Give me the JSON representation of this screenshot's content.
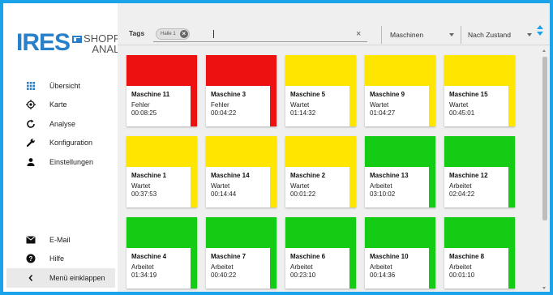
{
  "logo": {
    "brand": "IRES",
    "line1": "SHOPFLOOR",
    "line2": "ANALYTICS"
  },
  "sidebar": {
    "items": [
      {
        "label": "Übersicht",
        "icon": "grid-icon"
      },
      {
        "label": "Karte",
        "icon": "location-icon"
      },
      {
        "label": "Analyse",
        "icon": "refresh-icon"
      },
      {
        "label": "Konfiguration",
        "icon": "wrench-icon"
      },
      {
        "label": "Einstellungen",
        "icon": "person-icon"
      }
    ],
    "bottom": [
      {
        "label": "E-Mail",
        "icon": "mail-icon"
      },
      {
        "label": "Hilfe",
        "icon": "help-icon"
      },
      {
        "label": "Menü einklappen",
        "icon": "chevron-left-icon"
      }
    ]
  },
  "filter": {
    "tags_label": "Tags",
    "chip_label": "Halle 1",
    "clear": "×",
    "select1": "Maschinen",
    "select2": "Nach Zustand"
  },
  "colors": {
    "red": "#ee1111",
    "yellow": "#ffe600",
    "green": "#14cc14",
    "accent": "#1aa3e8"
  },
  "machines": [
    {
      "name": "Maschine 11",
      "state": "Fehler",
      "time": "00:08:25",
      "status": "red"
    },
    {
      "name": "Maschine 3",
      "state": "Fehler",
      "time": "00:04:22",
      "status": "red"
    },
    {
      "name": "Maschine 5",
      "state": "Wartet",
      "time": "01:14:32",
      "status": "yellow"
    },
    {
      "name": "Maschine 9",
      "state": "Wartet",
      "time": "01:04:27",
      "status": "yellow"
    },
    {
      "name": "Maschine 15",
      "state": "Wartet",
      "time": "00:45:01",
      "status": "yellow"
    },
    {
      "name": "Maschine 1",
      "state": "Wartet",
      "time": "00:37:53",
      "status": "yellow"
    },
    {
      "name": "Maschine 14",
      "state": "Wartet",
      "time": "00:14:44",
      "status": "yellow"
    },
    {
      "name": "Maschine 2",
      "state": "Wartet",
      "time": "00:01:22",
      "status": "yellow"
    },
    {
      "name": "Maschine 13",
      "state": "Arbeitet",
      "time": "03:10:02",
      "status": "green"
    },
    {
      "name": "Maschine 12",
      "state": "Arbeitet",
      "time": "02:04:22",
      "status": "green"
    },
    {
      "name": "Maschine 4",
      "state": "Arbeitet",
      "time": "01:34:19",
      "status": "green"
    },
    {
      "name": "Maschine 7",
      "state": "Arbeitet",
      "time": "00:40:22",
      "status": "green"
    },
    {
      "name": "Maschine 6",
      "state": "Arbeitet",
      "time": "00:23:10",
      "status": "green"
    },
    {
      "name": "Maschine 10",
      "state": "Arbeitet",
      "time": "00:14:36",
      "status": "green"
    },
    {
      "name": "Maschine 8",
      "state": "Arbeitet",
      "time": "00:01:10",
      "status": "green"
    }
  ]
}
